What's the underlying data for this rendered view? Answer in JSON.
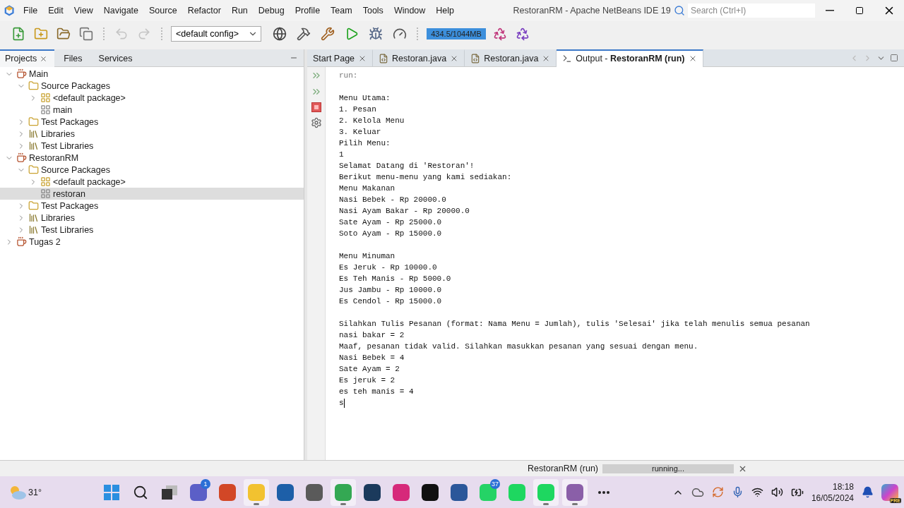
{
  "window": {
    "title": "RestoranRM - Apache NetBeans IDE 19",
    "search_placeholder": "Search (Ctrl+I)"
  },
  "menu": [
    "File",
    "Edit",
    "View",
    "Navigate",
    "Source",
    "Refactor",
    "Run",
    "Debug",
    "Profile",
    "Team",
    "Tools",
    "Window",
    "Help"
  ],
  "toolbar": {
    "left_buttons": [
      {
        "kind": "new-file",
        "disabled": false
      },
      {
        "kind": "new-project",
        "disabled": false
      },
      {
        "kind": "open-project",
        "disabled": false
      },
      {
        "kind": "close-project",
        "disabled": false
      },
      {
        "kind": "undo",
        "disabled": true
      },
      {
        "kind": "redo",
        "disabled": true
      }
    ],
    "config": "<default config>",
    "right_buttons": [
      {
        "kind": "globe"
      },
      {
        "kind": "build"
      },
      {
        "kind": "clean-build"
      },
      {
        "kind": "run"
      },
      {
        "kind": "debug"
      },
      {
        "kind": "profile"
      }
    ],
    "memory": {
      "reading": "434.5/1044MB",
      "level": 1
    }
  },
  "side_tabs": [
    {
      "label": "Projects",
      "selected": true
    },
    {
      "label": "Files",
      "selected": false
    },
    {
      "label": "Services",
      "selected": false
    }
  ],
  "tree": [
    {
      "label": "Main",
      "kind": "project",
      "expanded": true,
      "selected": false,
      "children": [
        {
          "label": "Source Packages",
          "kind": "source-folder",
          "expanded": true,
          "selected": false,
          "children": [
            {
              "label": "<default package>",
              "kind": "package",
              "expanded": false,
              "selected": false
            },
            {
              "label": "main",
              "kind": "empty-package",
              "selected": false
            }
          ]
        },
        {
          "label": "Test Packages",
          "kind": "source-folder",
          "expanded": false,
          "selected": false
        },
        {
          "label": "Libraries",
          "kind": "library-folder",
          "expanded": false,
          "selected": false
        },
        {
          "label": "Test Libraries",
          "kind": "library-folder",
          "expanded": false,
          "selected": false
        }
      ]
    },
    {
      "label": "RestoranRM",
      "kind": "project",
      "expanded": true,
      "selected": false,
      "children": [
        {
          "label": "Source Packages",
          "kind": "source-folder",
          "expanded": true,
          "selected": false,
          "children": [
            {
              "label": "<default package>",
              "kind": "package",
              "expanded": false,
              "selected": false
            },
            {
              "label": "restoran",
              "kind": "empty-package",
              "selected": true
            }
          ]
        },
        {
          "label": "Test Packages",
          "kind": "source-folder",
          "expanded": false,
          "selected": false
        },
        {
          "label": "Libraries",
          "kind": "library-folder",
          "expanded": false,
          "selected": false
        },
        {
          "label": "Test Libraries",
          "kind": "library-folder",
          "expanded": false,
          "selected": false
        }
      ]
    },
    {
      "label": "Tugas 2",
      "kind": "project",
      "expanded": false,
      "selected": false
    }
  ],
  "editor_tabs": [
    {
      "label": "Start Page",
      "kind": "page",
      "selected": false
    },
    {
      "label": "Restoran.java",
      "kind": "java",
      "selected": false
    },
    {
      "label": "Restoran.java",
      "kind": "java",
      "selected": false
    },
    {
      "label": "Output - ",
      "bold": "RestoranRM (run)",
      "kind": "output",
      "selected": true
    }
  ],
  "output_blocks": [
    {
      "kind": "system",
      "lines": [
        "run:"
      ]
    },
    {
      "kind": "program",
      "lines": [
        "Menu Utama:",
        "1. Pesan",
        "2. Kelola Menu",
        "3. Keluar",
        "Pilih Menu:",
        "1",
        "Selamat Datang di 'Restoran'!",
        "Berikut menu-menu yang kami sediakan:",
        "Menu Makanan",
        "Nasi Bebek - Rp 20000.0",
        "Nasi Ayam Bakar - Rp 20000.0",
        "Sate Ayam - Rp 25000.0",
        "Soto Ayam - Rp 15000.0"
      ]
    },
    {
      "kind": "program",
      "lines": [
        "Menu Minuman",
        "Es Jeruk - Rp 10000.0",
        "Es Teh Manis - Rp 5000.0",
        "Jus Jambu - Rp 10000.0",
        "Es Cendol - Rp 15000.0"
      ]
    },
    {
      "kind": "program",
      "lines": [
        "Silahkan Tulis Pesanan (format: Nama Menu = Jumlah), tulis 'Selesai' jika telah menulis semua pesanan",
        "nasi bakar = 2",
        "Maaf, pesanan tidak valid. Silahkan masukkan pesanan yang sesuai dengan menu.",
        "Nasi Bebek = 4",
        "Sate Ayam = 2",
        "Es jeruk = 2",
        "es teh manis = 4",
        "s"
      ]
    }
  ],
  "status_bar": {
    "task": "RestoranRM (run)",
    "progress": "running...",
    "level": 1
  },
  "taskbar": {
    "weather": "31°",
    "apps": [
      {
        "kind": "start",
        "color": "#2b8fe0",
        "active": false
      },
      {
        "kind": "search",
        "active": false
      },
      {
        "kind": "task-view",
        "color": "#333333",
        "active": false
      },
      {
        "kind": "app",
        "color": "#5b5fc7",
        "badge": "1",
        "active": false
      },
      {
        "kind": "app",
        "color": "#d24726",
        "active": false
      },
      {
        "kind": "app",
        "color": "#f2c230",
        "active": true
      },
      {
        "kind": "app",
        "color": "#1d5fa8",
        "active": false
      },
      {
        "kind": "app",
        "color": "#5a5a5a",
        "active": false
      },
      {
        "kind": "app",
        "color": "#34a853",
        "active": true
      },
      {
        "kind": "app",
        "color": "#1b3a5c",
        "active": false
      },
      {
        "kind": "app",
        "color": "#d6297a",
        "active": false
      },
      {
        "kind": "app",
        "color": "#111111",
        "active": false
      },
      {
        "kind": "app",
        "color": "#2b579a",
        "active": false
      },
      {
        "kind": "app",
        "color": "#25d366",
        "badge": "37",
        "active": false
      },
      {
        "kind": "app",
        "color": "#1ed760",
        "active": false
      },
      {
        "kind": "app",
        "color": "#1ed760",
        "active": true
      },
      {
        "kind": "app",
        "color": "#8a5fa8",
        "active": true
      },
      {
        "kind": "more",
        "active": false
      }
    ],
    "time": "18:18",
    "date": "16/05/2024",
    "copilot_badge": "PRE"
  }
}
